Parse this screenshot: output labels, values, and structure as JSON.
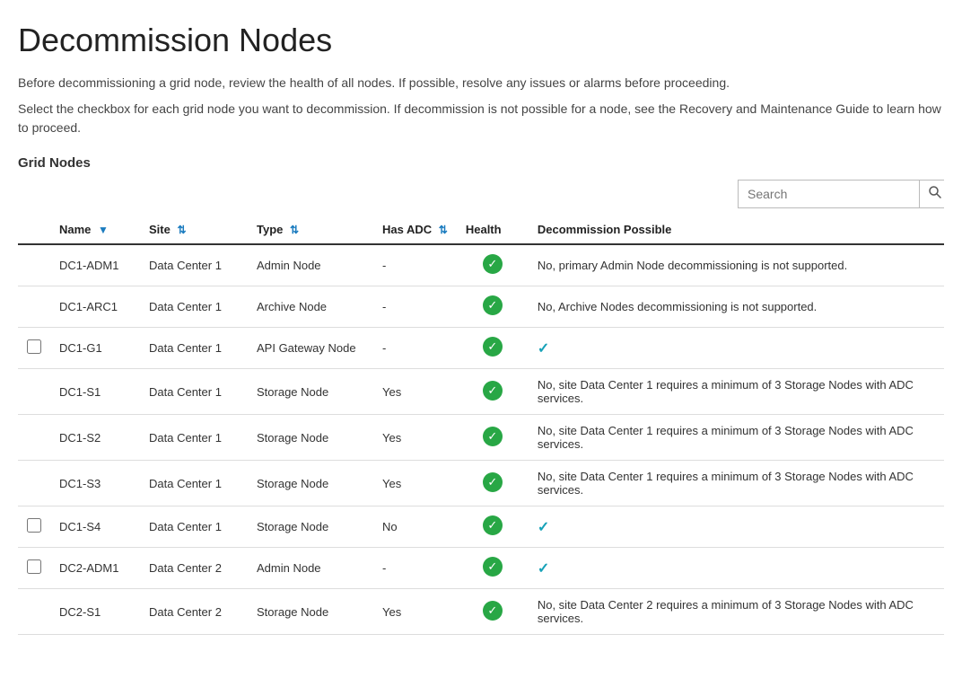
{
  "page": {
    "title": "Decommission Nodes",
    "description1": "Before decommissioning a grid node, review the health of all nodes. If possible, resolve any issues or alarms before proceeding.",
    "description2": "Select the checkbox for each grid node you want to decommission. If decommission is not possible for a node, see the Recovery and Maintenance Guide to learn how to proceed.",
    "section_title": "Grid Nodes"
  },
  "search": {
    "placeholder": "Search",
    "button_label": "🔍"
  },
  "table": {
    "headers": [
      {
        "id": "checkbox",
        "label": ""
      },
      {
        "id": "name",
        "label": "Name",
        "sort": "down"
      },
      {
        "id": "site",
        "label": "Site",
        "sort": "updown"
      },
      {
        "id": "type",
        "label": "Type",
        "sort": "updown"
      },
      {
        "id": "has_adc",
        "label": "Has ADC",
        "sort": "updown"
      },
      {
        "id": "health",
        "label": "Health",
        "sort": "none"
      },
      {
        "id": "decommission_possible",
        "label": "Decommission Possible",
        "sort": "none"
      }
    ],
    "rows": [
      {
        "checkbox": false,
        "show_checkbox": false,
        "name": "DC1-ADM1",
        "site": "Data Center 1",
        "type": "Admin Node",
        "has_adc": "-",
        "health": "green_check",
        "decommission_possible": "No, primary Admin Node decommissioning is not supported."
      },
      {
        "checkbox": false,
        "show_checkbox": false,
        "name": "DC1-ARC1",
        "site": "Data Center 1",
        "type": "Archive Node",
        "has_adc": "-",
        "health": "green_check",
        "decommission_possible": "No, Archive Nodes decommissioning is not supported."
      },
      {
        "checkbox": false,
        "show_checkbox": true,
        "name": "DC1-G1",
        "site": "Data Center 1",
        "type": "API Gateway Node",
        "has_adc": "-",
        "health": "green_check",
        "decommission_possible": "teal_check"
      },
      {
        "checkbox": false,
        "show_checkbox": false,
        "name": "DC1-S1",
        "site": "Data Center 1",
        "type": "Storage Node",
        "has_adc": "Yes",
        "health": "green_check",
        "decommission_possible": "No, site Data Center 1 requires a minimum of 3 Storage Nodes with ADC services."
      },
      {
        "checkbox": false,
        "show_checkbox": false,
        "name": "DC1-S2",
        "site": "Data Center 1",
        "type": "Storage Node",
        "has_adc": "Yes",
        "health": "green_check",
        "decommission_possible": "No, site Data Center 1 requires a minimum of 3 Storage Nodes with ADC services."
      },
      {
        "checkbox": false,
        "show_checkbox": false,
        "name": "DC1-S3",
        "site": "Data Center 1",
        "type": "Storage Node",
        "has_adc": "Yes",
        "health": "green_check",
        "decommission_possible": "No, site Data Center 1 requires a minimum of 3 Storage Nodes with ADC services."
      },
      {
        "checkbox": false,
        "show_checkbox": true,
        "name": "DC1-S4",
        "site": "Data Center 1",
        "type": "Storage Node",
        "has_adc": "No",
        "health": "green_check",
        "decommission_possible": "teal_check"
      },
      {
        "checkbox": false,
        "show_checkbox": true,
        "name": "DC2-ADM1",
        "site": "Data Center 2",
        "type": "Admin Node",
        "has_adc": "-",
        "health": "green_check",
        "decommission_possible": "teal_check"
      },
      {
        "checkbox": false,
        "show_checkbox": false,
        "name": "DC2-S1",
        "site": "Data Center 2",
        "type": "Storage Node",
        "has_adc": "Yes",
        "health": "green_check",
        "decommission_possible": "No, site Data Center 2 requires a minimum of 3 Storage Nodes with ADC services."
      }
    ]
  }
}
